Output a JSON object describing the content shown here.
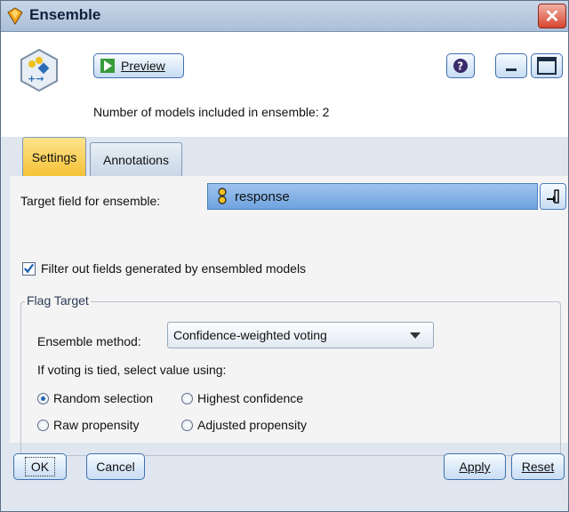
{
  "window": {
    "title": "Ensemble"
  },
  "toolbar": {
    "preview_label": "Preview"
  },
  "header": {
    "models_text": "Number of models included in ensemble: 2"
  },
  "tabs": [
    {
      "label": "Settings",
      "active": true
    },
    {
      "label": "Annotations",
      "active": false
    }
  ],
  "settings": {
    "target_label": "Target field for ensemble:",
    "target_value": "response",
    "filter_label": "Filter out fields generated by ensembled models",
    "filter_checked": true,
    "flag_target": {
      "legend": "Flag Target",
      "method_label": "Ensemble method:",
      "method_value": "Confidence-weighted voting",
      "tie_label": "If voting is tied, select value using:",
      "options": [
        {
          "label": "Random selection",
          "selected": true
        },
        {
          "label": "Highest confidence",
          "selected": false
        },
        {
          "label": "Raw propensity",
          "selected": false
        },
        {
          "label": "Adjusted propensity",
          "selected": false
        }
      ]
    }
  },
  "buttons": {
    "ok": "OK",
    "cancel": "Cancel",
    "apply": "Apply",
    "reset": "Reset"
  },
  "colors": {
    "accent_tab": "#f6c238",
    "target_field": "#6fa3e0",
    "close": "#d8452f"
  },
  "icons": [
    "ensemble-node-icon",
    "preview-icon",
    "help-icon",
    "minimize-icon",
    "maximize-icon",
    "close-icon",
    "flag-icon",
    "field-picker-icon"
  ]
}
